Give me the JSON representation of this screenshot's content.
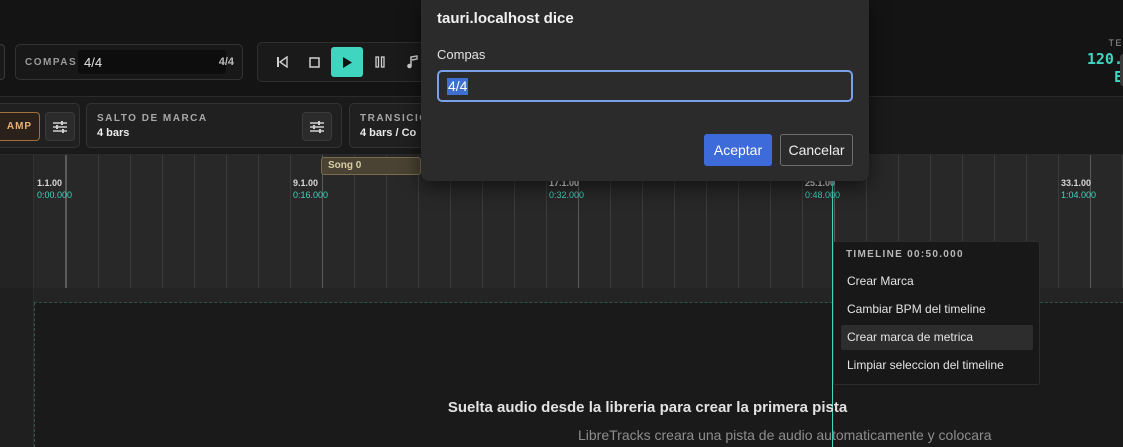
{
  "transport": {
    "compas_label": "COMPAS",
    "compas_input_value": "4/4",
    "compas_display": "4/4",
    "tempo_label": "TE",
    "tempo_value": "120.",
    "tempo_sub": "E"
  },
  "controls": {
    "ramp_label": "AMP",
    "salto_title": "SALTO DE MARCA",
    "salto_value": "4 bars",
    "transicion_title": "TRANSICIO",
    "transicion_value": "4 bars / Co"
  },
  "timeline": {
    "song_chip": "Song 0",
    "markers": [
      {
        "bar": "1.1.00",
        "time": "0:00.000"
      },
      {
        "bar": "9.1.00",
        "time": "0:16.000"
      },
      {
        "bar": "17.1.00",
        "time": "0:32.000"
      },
      {
        "bar": "25.1.00",
        "time": "0:48.000"
      },
      {
        "bar": "33.1.00",
        "time": "1:04.000"
      }
    ]
  },
  "drop_zone": {
    "title": "Suelta audio desde la libreria para crear la primera pista",
    "subtitle": "LibreTracks creara una pista de audio automaticamente y colocara"
  },
  "context_menu": {
    "title": "TIMELINE 00:50.000",
    "items": [
      "Crear Marca",
      "Cambiar BPM del timeline",
      "Crear marca de metrica",
      "Limpiar seleccion del timeline"
    ]
  },
  "dialog": {
    "title": "tauri.localhost dice",
    "label": "Compas",
    "input_value": "4/4",
    "ok_label": "Aceptar",
    "cancel_label": "Cancelar"
  },
  "colors": {
    "accent": "#3fd5bf",
    "ramp": "#e8b074",
    "dialog_button": "#3d6bd9"
  }
}
